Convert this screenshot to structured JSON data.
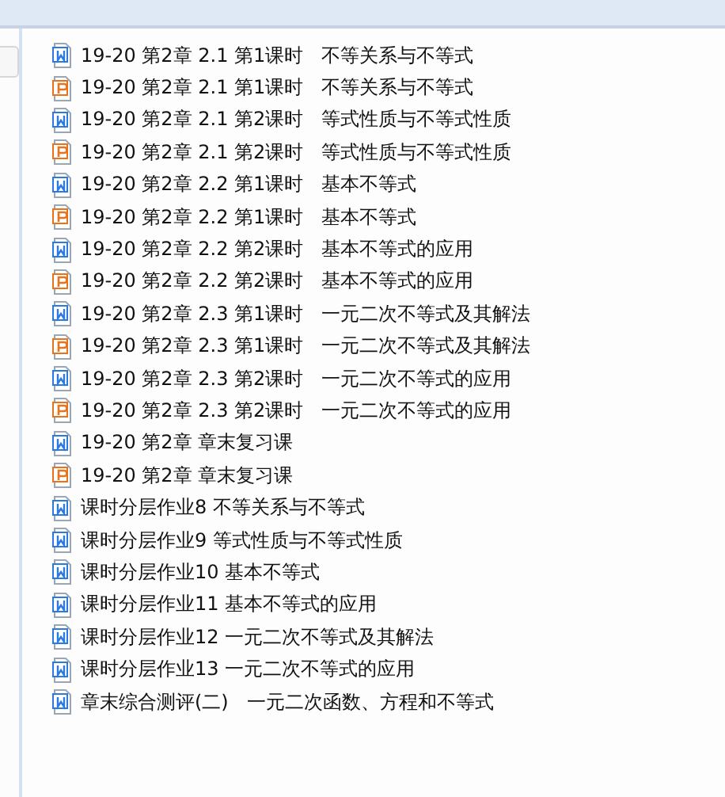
{
  "files": [
    {
      "name": "19-20 第2章 2.1 第1课时   不等关系与不等式",
      "kind": "word"
    },
    {
      "name": "19-20 第2章 2.1 第1课时   不等关系与不等式",
      "kind": "ppt"
    },
    {
      "name": "19-20 第2章 2.1 第2课时   等式性质与不等式性质",
      "kind": "word"
    },
    {
      "name": "19-20 第2章 2.1 第2课时   等式性质与不等式性质",
      "kind": "ppt"
    },
    {
      "name": "19-20 第2章 2.2 第1课时   基本不等式",
      "kind": "word"
    },
    {
      "name": "19-20 第2章 2.2 第1课时   基本不等式",
      "kind": "ppt"
    },
    {
      "name": "19-20 第2章 2.2 第2课时   基本不等式的应用",
      "kind": "word"
    },
    {
      "name": "19-20 第2章 2.2 第2课时   基本不等式的应用",
      "kind": "ppt"
    },
    {
      "name": "19-20 第2章 2.3 第1课时   一元二次不等式及其解法",
      "kind": "word"
    },
    {
      "name": "19-20 第2章 2.3 第1课时   一元二次不等式及其解法",
      "kind": "ppt"
    },
    {
      "name": "19-20 第2章 2.3 第2课时   一元二次不等式的应用",
      "kind": "word"
    },
    {
      "name": "19-20 第2章 2.3 第2课时   一元二次不等式的应用",
      "kind": "ppt"
    },
    {
      "name": "19-20 第2章 章末复习课",
      "kind": "word"
    },
    {
      "name": "19-20 第2章 章末复习课",
      "kind": "ppt"
    },
    {
      "name": "课时分层作业8 不等关系与不等式",
      "kind": "word"
    },
    {
      "name": "课时分层作业9 等式性质与不等式性质",
      "kind": "word"
    },
    {
      "name": "课时分层作业10 基本不等式",
      "kind": "word"
    },
    {
      "name": "课时分层作业11 基本不等式的应用",
      "kind": "word"
    },
    {
      "name": "课时分层作业12 一元二次不等式及其解法",
      "kind": "word"
    },
    {
      "name": "课时分层作业13 一元二次不等式的应用",
      "kind": "word"
    },
    {
      "name": "章末综合测评(二)   一元二次函数、方程和不等式",
      "kind": "word"
    }
  ]
}
